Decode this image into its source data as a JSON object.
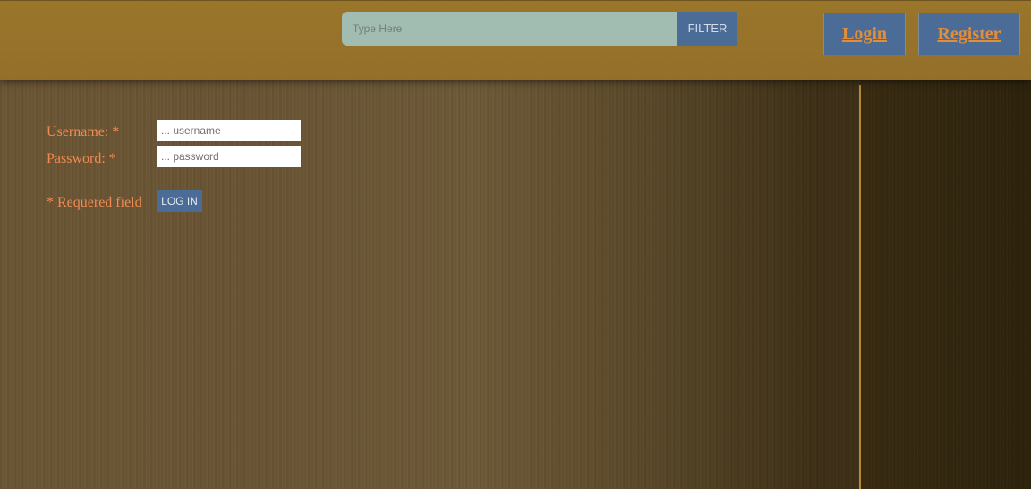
{
  "header": {
    "search": {
      "placeholder": "Type Here",
      "button_label": "FILTER"
    },
    "nav": {
      "login_label": "Login",
      "register_label": "Register"
    }
  },
  "login_form": {
    "username_label": "Username: *",
    "username_placeholder": "... username",
    "password_label": "Password: *",
    "password_placeholder": "... password",
    "required_note": "* Requered field",
    "submit_label": "LOG IN"
  },
  "colors": {
    "header_bg": "#9a762b",
    "button_bg": "#4a6c96",
    "label_text": "#f08a52",
    "nav_text": "#e08d3c",
    "search_bg": "#a1bcb0"
  }
}
